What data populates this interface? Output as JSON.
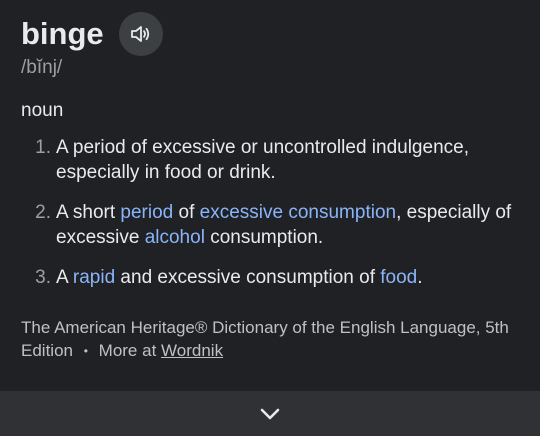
{
  "entry": {
    "headword": "binge",
    "pronunciation": "/bĭnj/",
    "part_of_speech": "noun",
    "speaker_icon": "speaker-icon",
    "senses": [
      {
        "number": "1.",
        "parts": [
          {
            "text": "A period of excessive or uncontrolled indulgence, especially in food or drink.",
            "link": false
          }
        ]
      },
      {
        "number": "2.",
        "parts": [
          {
            "text": "A short ",
            "link": false
          },
          {
            "text": "period",
            "link": true
          },
          {
            "text": " of ",
            "link": false
          },
          {
            "text": "excessive consumption",
            "link": true
          },
          {
            "text": ", especially of excessive ",
            "link": false
          },
          {
            "text": "alcohol",
            "link": true
          },
          {
            "text": " consumption.",
            "link": false
          }
        ]
      },
      {
        "number": "3.",
        "parts": [
          {
            "text": "A ",
            "link": false
          },
          {
            "text": "rapid",
            "link": true
          },
          {
            "text": " and excessive consumption of ",
            "link": false
          },
          {
            "text": "food",
            "link": true
          },
          {
            "text": ".",
            "link": false
          }
        ]
      }
    ]
  },
  "source": {
    "text": "The American Heritage® Dictionary of the English Language, 5th Edition",
    "separator": "•",
    "more_at": "More at",
    "wordnik": "Wordnik"
  },
  "expand_icon": "chevron-down-icon",
  "colors": {
    "background": "#202124",
    "link": "#8ab4f8",
    "bottom_bar": "#303134"
  }
}
